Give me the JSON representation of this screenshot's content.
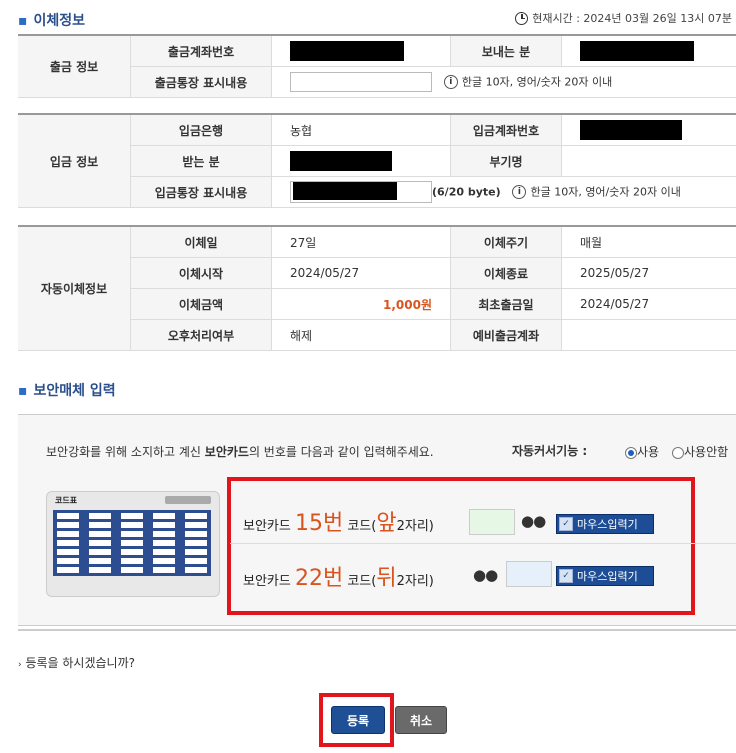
{
  "transfer_section": {
    "title": "이체정보",
    "current_time": "현재시간 : 2024년 03월 26일 13시 07분"
  },
  "withdraw": {
    "group_label": "출금 정보",
    "account_label": "출금계좌번호",
    "sender_label": "보내는 분",
    "memo_label": "출금통장 표시내용",
    "memo_value": "",
    "memo_hint": "한글 10자, 영어/숫자 20자 이내"
  },
  "deposit": {
    "group_label": "입금 정보",
    "bank_label": "입금은행",
    "bank_value": "농협",
    "account_label": "입금계좌번호",
    "receiver_label": "받는 분",
    "extra_label": "부기명",
    "memo_label": "입금통장 표시내용",
    "memo_count": "(6/20 byte)",
    "memo_hint": "한글 10자, 영어/숫자 20자 이내"
  },
  "auto": {
    "group_label": "자동이체정보",
    "day_label": "이체일",
    "day_value": "27일",
    "cycle_label": "이체주기",
    "cycle_value": "매월",
    "start_label": "이체시작",
    "start_value": "2024/05/27",
    "end_label": "이체종료",
    "end_value": "2025/05/27",
    "amount_label": "이체금액",
    "amount_value": "1,000원",
    "first_label": "최초출금일",
    "first_value": "2024/05/27",
    "afternoon_label": "오후처리여부",
    "afternoon_value": "해제",
    "reserve_label": "예비출금계좌",
    "reserve_value": ""
  },
  "security": {
    "title": "보안매체 입력",
    "guide_pre": "보안강화를 위해 소지하고 계신 ",
    "guide_bold": "보안카드",
    "guide_post": "의 번호를 다음과 같이 입력해주세요.",
    "auto_cursor_label": "자동커서기능 :",
    "opt_use": "사용",
    "opt_nouse": "사용안함",
    "card_title": "코드표",
    "row1": {
      "prefix": "보안카드 ",
      "num": "15번",
      "mid": " 코드(",
      "pos": "앞",
      "suffix": "2자리)",
      "dots": "●●"
    },
    "row2": {
      "prefix": "보안카드 ",
      "num": "22번",
      "mid": " 코드(",
      "pos": "뒤",
      "suffix": "2자리)",
      "dots": "●●"
    },
    "mouse_input": "마우스입력기"
  },
  "confirm_question": "등록을 하시겠습니까?",
  "buttons": {
    "register": "등록",
    "cancel": "취소"
  },
  "colors": {
    "accent": "#2b4f8a",
    "alert": "#e0161c",
    "highlight": "#d9541e"
  }
}
